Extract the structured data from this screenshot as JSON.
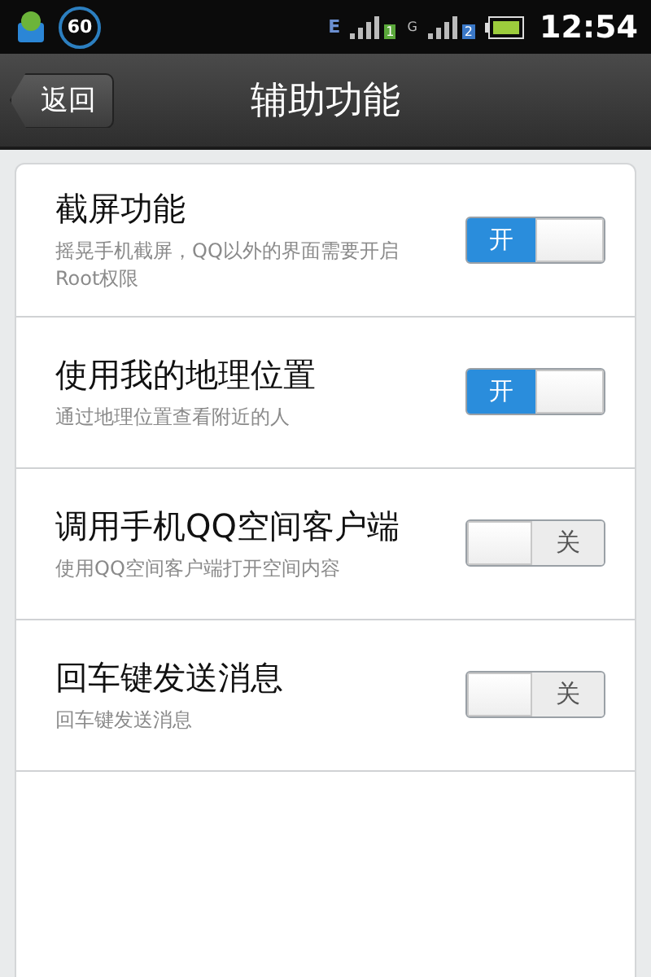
{
  "status_bar": {
    "badge": "60",
    "network": "E",
    "sim_1": "1",
    "sim_2_network": "G",
    "sim_2": "2",
    "time": "12:54"
  },
  "header": {
    "back": "返回",
    "title": "辅助功能"
  },
  "settings": [
    {
      "title": "截屏功能",
      "description": "摇晃手机截屏，QQ以外的界面需要开启Root权限",
      "on": true,
      "switch_text": "开"
    },
    {
      "title": "使用我的地理位置",
      "description": "通过地理位置查看附近的人",
      "on": true,
      "switch_text": "开"
    },
    {
      "title": "调用手机QQ空间客户端",
      "description": "使用QQ空间客户端打开空间内容",
      "on": false,
      "switch_text": "关"
    },
    {
      "title": "回车键发送消息",
      "description": "回车键发送消息",
      "on": false,
      "switch_text": "关"
    }
  ]
}
